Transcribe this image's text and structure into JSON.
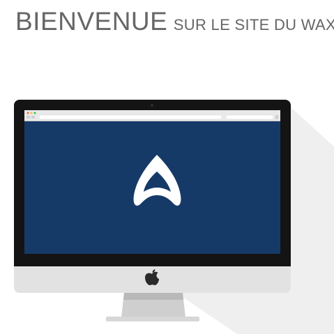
{
  "header": {
    "title_big": "BIENVENUE",
    "title_small": "SUR LE SITE DU WAX"
  },
  "browser": {
    "url": "",
    "search": ""
  },
  "colors": {
    "screen_bg": "#163a68",
    "bezel": "#151515",
    "chin": "#e4e4e4",
    "shadow": "#eeeeee",
    "text": "#666666"
  },
  "icons": {
    "logo": "wax-a-logo-icon",
    "brand": "apple-logo-icon"
  }
}
